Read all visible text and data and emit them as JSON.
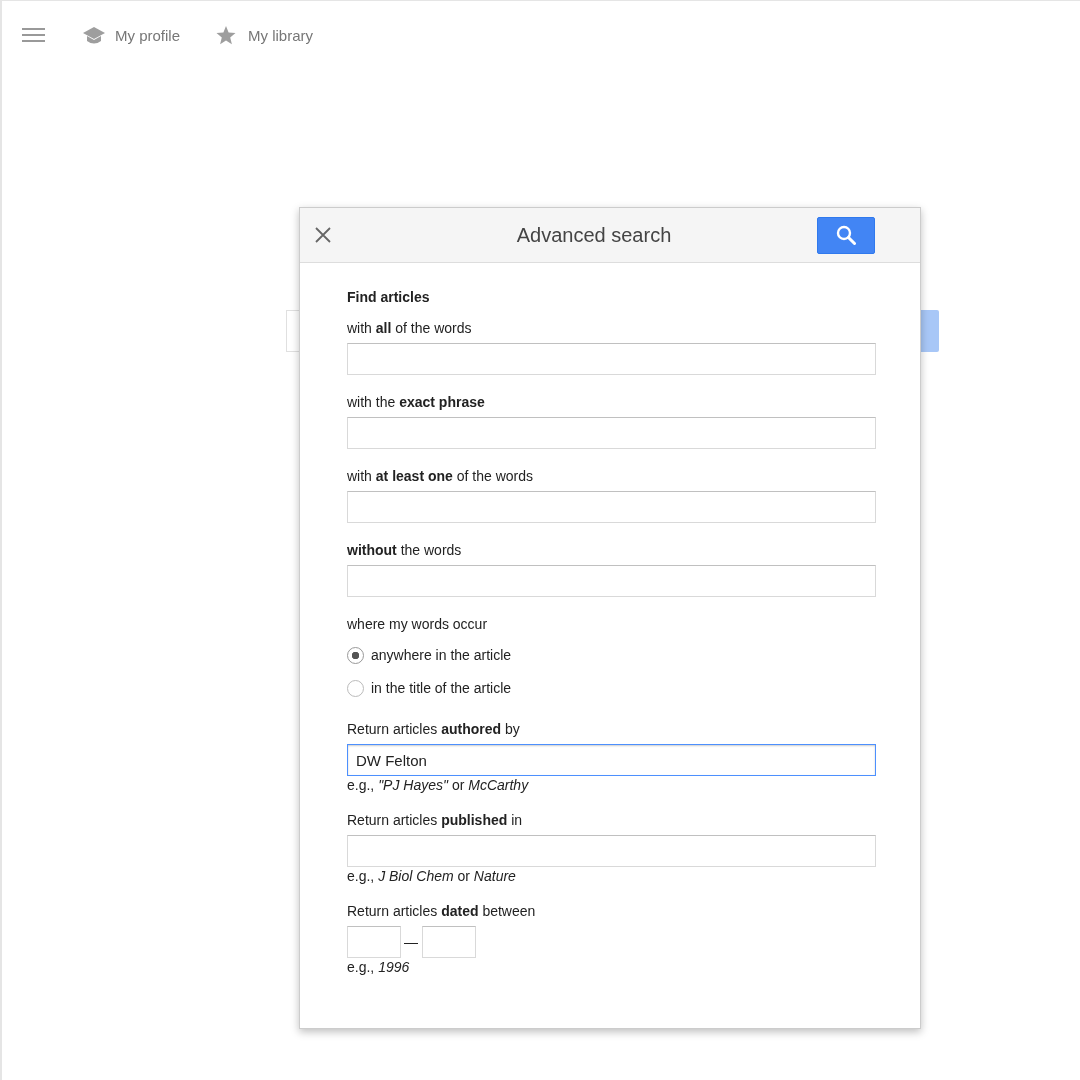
{
  "nav": {
    "items": [
      {
        "kind": "profile",
        "label": "My profile"
      },
      {
        "kind": "library",
        "label": "My library"
      }
    ]
  },
  "dialog": {
    "title": "Advanced search",
    "heading": "Find articles",
    "items": [
      {
        "kind": "text",
        "label": "with **all** of the words"
      },
      {
        "kind": "text",
        "label": "with the **exact phrase**"
      },
      {
        "kind": "text",
        "label": "with **at least one** of the words"
      },
      {
        "kind": "text",
        "label": "**without** the words"
      },
      {
        "kind": "radio",
        "label": "where my words occur",
        "options": [
          {
            "label": "anywhere in the article",
            "selected": true
          },
          {
            "label": "in the title of the article",
            "selected": false
          }
        ]
      },
      {
        "kind": "text",
        "label": "Return articles **authored** by",
        "value": "DW Felton",
        "focused": true,
        "hint": "e.g., *\"PJ Hayes\"* or *McCarthy*"
      },
      {
        "kind": "text",
        "label": "Return articles **published** in",
        "focused": false,
        "hint": "e.g., *J Biol Chem* or *Nature*"
      },
      {
        "kind": "dates",
        "label": "Return articles **dated** between",
        "separator": "—",
        "hint": "e.g., *1996*"
      }
    ]
  }
}
